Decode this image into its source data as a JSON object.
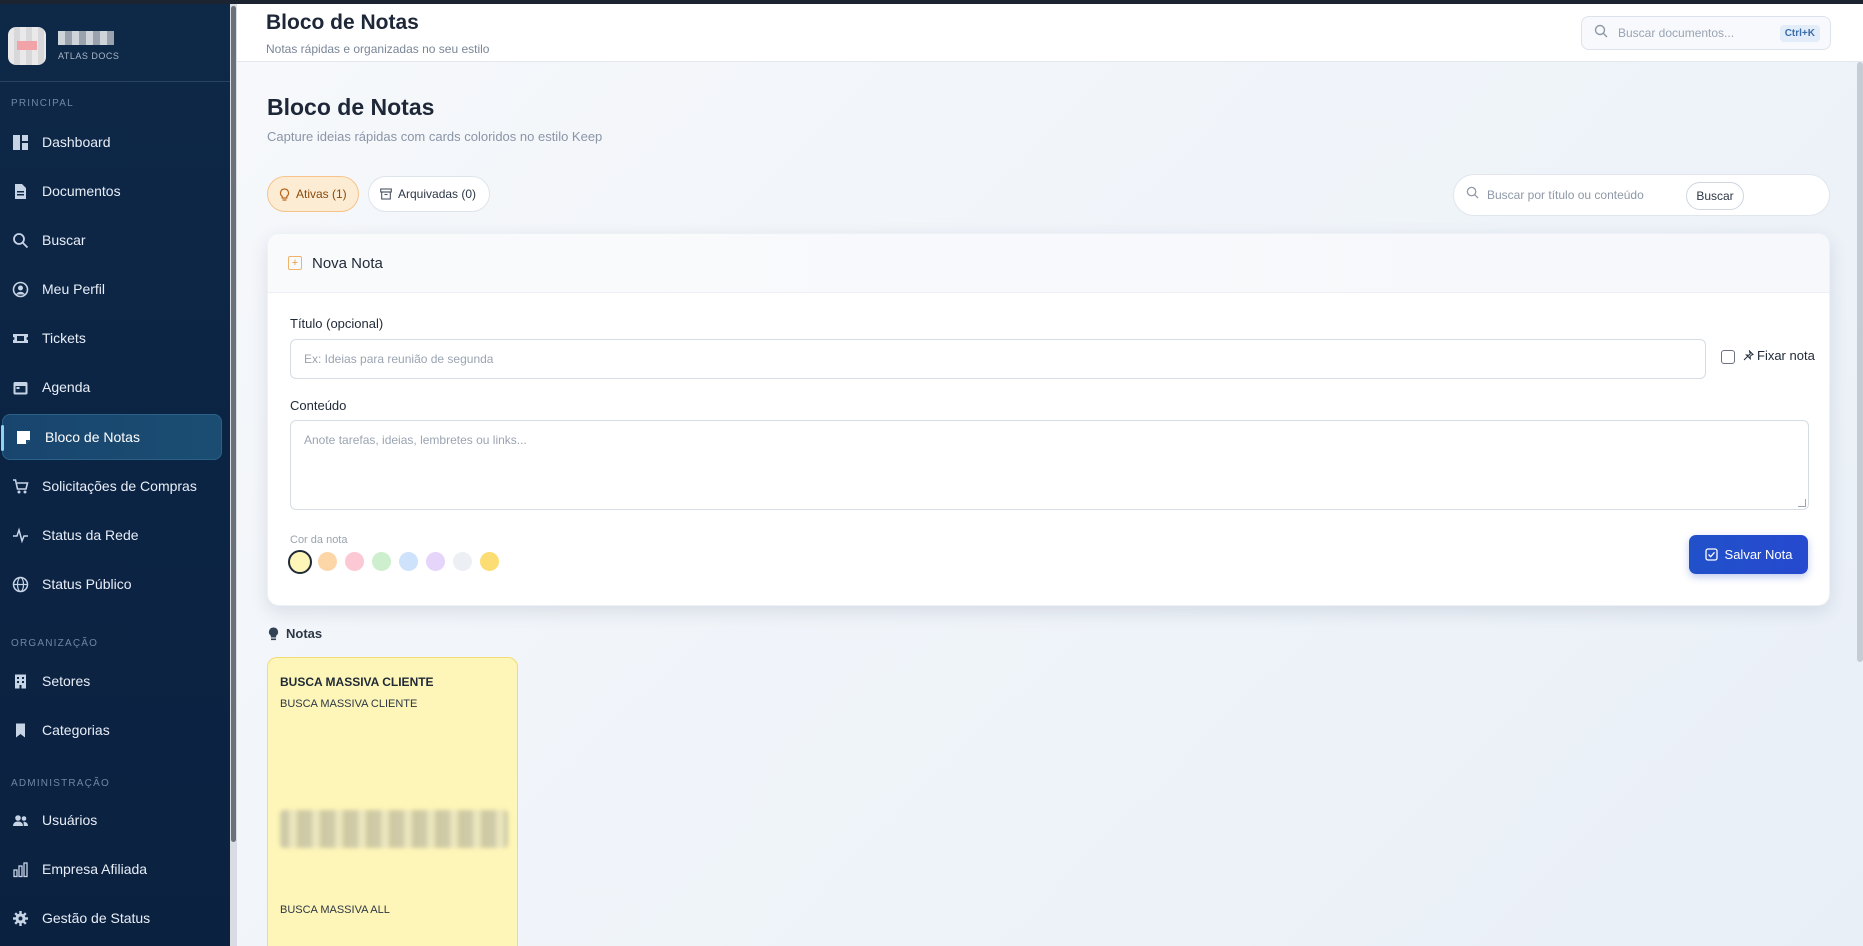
{
  "sidebar": {
    "brand_sub": "ATLAS DOCS",
    "sections": {
      "principal": "PRINCIPAL",
      "organizacao": "ORGANIZAÇÃO",
      "administracao": "ADMINISTRAÇÃO"
    },
    "items": [
      {
        "label": "Dashboard",
        "icon": "dashboard-icon"
      },
      {
        "label": "Documentos",
        "icon": "document-icon"
      },
      {
        "label": "Buscar",
        "icon": "search-icon"
      },
      {
        "label": "Meu Perfil",
        "icon": "user-circle-icon"
      },
      {
        "label": "Tickets",
        "icon": "ticket-icon"
      },
      {
        "label": "Agenda",
        "icon": "calendar-icon"
      },
      {
        "label": "Bloco de Notas",
        "icon": "sticky-note-icon",
        "active": true
      },
      {
        "label": "Solicitações de Compras",
        "icon": "cart-icon"
      },
      {
        "label": "Status da Rede",
        "icon": "activity-icon"
      },
      {
        "label": "Status Público",
        "icon": "globe-icon"
      },
      {
        "label": "Setores",
        "icon": "building-icon"
      },
      {
        "label": "Categorias",
        "icon": "bookmark-icon"
      },
      {
        "label": "Usuários",
        "icon": "users-icon"
      },
      {
        "label": "Empresa Afiliada",
        "icon": "chart-building-icon"
      },
      {
        "label": "Gestão de Status",
        "icon": "gear-icon"
      }
    ]
  },
  "header": {
    "title": "Bloco de Notas",
    "subtitle": "Notas rápidas e organizadas no seu estilo",
    "search_placeholder": "Buscar documentos...",
    "search_shortcut": "Ctrl+K"
  },
  "page": {
    "title": "Bloco de Notas",
    "subtitle": "Capture ideias rápidas com cards coloridos no estilo Keep"
  },
  "tabs": {
    "active": "Ativas (1)",
    "archived": "Arquivadas (0)"
  },
  "filter": {
    "placeholder": "Buscar por título ou conteúdo",
    "button": "Buscar"
  },
  "form": {
    "header": "Nova Nota",
    "title_label": "Título (opcional)",
    "title_placeholder": "Ex: Ideias para reunião de segunda",
    "pin_label": "Fixar nota",
    "content_label": "Conteúdo",
    "content_placeholder": "Anote tarefas, ideias, lembretes ou links...",
    "color_label": "Cor da nota",
    "colors": [
      "#fef6b8",
      "#fdd6a8",
      "#fbc8d4",
      "#cdefcd",
      "#cfe2fb",
      "#e6d5fa",
      "#eceff3",
      "#fbdd74"
    ],
    "save_button": "Salvar Nota"
  },
  "notes_section": {
    "label": "Notas",
    "items": [
      {
        "title": "BUSCA MASSIVA CLIENTE",
        "line1": "BUSCA MASSIVA CLIENTE",
        "line3": "BUSCA MASSIVA ALL",
        "color": "#fef6b8"
      }
    ]
  }
}
